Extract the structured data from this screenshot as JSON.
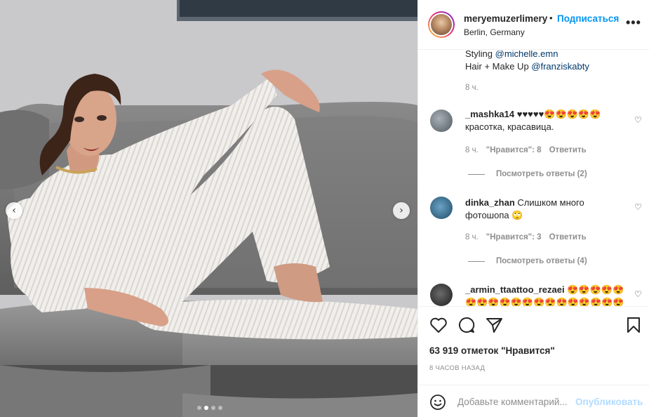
{
  "post": {
    "photo_alt": "",
    "carousel": {
      "total": 4,
      "active_index": 1
    }
  },
  "header": {
    "username": "meryemuzerlimery",
    "bullet": "•",
    "follow_label": "Подписаться",
    "location": "Berlin, Germany",
    "more_label": "•••"
  },
  "caption": {
    "line1_prefix": "Styling ",
    "line1_mention": "@michelle.emn",
    "line2_prefix": "Hair + Make Up ",
    "line2_mention": "@franziskabty",
    "time": "8 ч."
  },
  "comments": [
    {
      "username": "_mashka14",
      "text": " ♥♥♥♥♥😍😍😍😍😍 красотка, красавица.",
      "time": "8 ч.",
      "likes": "\"Нравится\": 8",
      "reply_label": "Ответить",
      "view_replies": "Посмотреть ответы (2)"
    },
    {
      "username": "dinka_zhan",
      "text": " Слишком много фотошопа 🙄",
      "time": "8 ч.",
      "likes": "\"Нравится\": 3",
      "reply_label": "Ответить",
      "view_replies": "Посмотреть ответы (4)"
    },
    {
      "username": "_armin_ttaattoo_rezaei",
      "text": " 😍😍😍😍😍 😍😍😍😍😍😍😍😍😍😍😍😍😍😍😍",
      "time": "",
      "likes": "",
      "reply_label": "",
      "view_replies": ""
    }
  ],
  "actions": {
    "likes_text": "63 919 отметок \"Нравится\"",
    "posted_ago": "8 часов назад"
  },
  "add_comment": {
    "placeholder": "Добавьте комментарий...",
    "publish_label": "Опубликовать"
  },
  "colors": {
    "accent": "#0095f6",
    "publish_disabled": "#b3dbff",
    "secondary_text": "#8e8e8e",
    "border": "#efefef"
  },
  "icons": {
    "like": "heart-outline-icon",
    "comment": "comment-bubble-icon",
    "share": "paper-plane-icon",
    "save": "bookmark-icon",
    "emoji": "smiley-icon",
    "more": "more-dots-icon",
    "prev": "chevron-left-icon",
    "next": "chevron-right-icon"
  }
}
